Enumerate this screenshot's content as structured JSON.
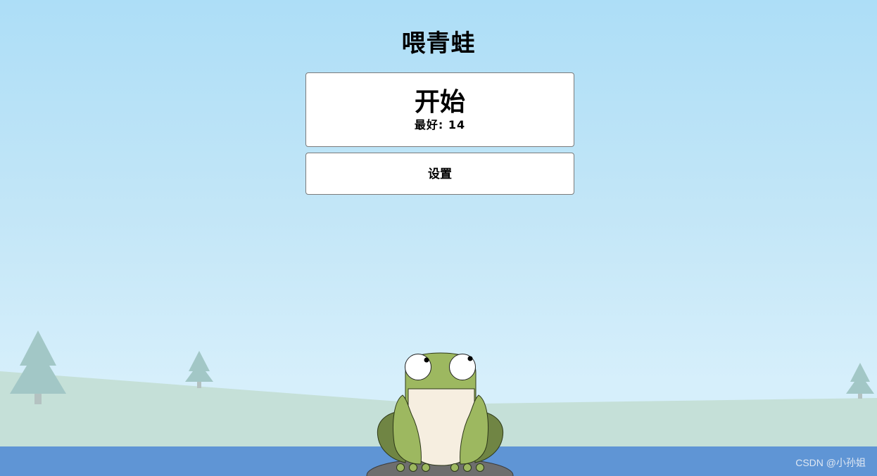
{
  "title": "喂青蛙",
  "menu": {
    "start_label": "开始",
    "best_label": "最好:",
    "best_value": "14",
    "settings_label": "设置"
  },
  "watermark": "CSDN @小孙姐",
  "colors": {
    "sky_top": "#addef7",
    "sky_bottom": "#d6effb",
    "hill": "#c5e0d8",
    "tree": "#a2c7c6",
    "water": "#5f95d5",
    "frog_body": "#9db860",
    "frog_shadow": "#708544",
    "frog_belly": "#f6eee0",
    "rock": "#6e6e6e"
  },
  "icons": {
    "frog": "frog-character",
    "trees": "pine-tree"
  }
}
